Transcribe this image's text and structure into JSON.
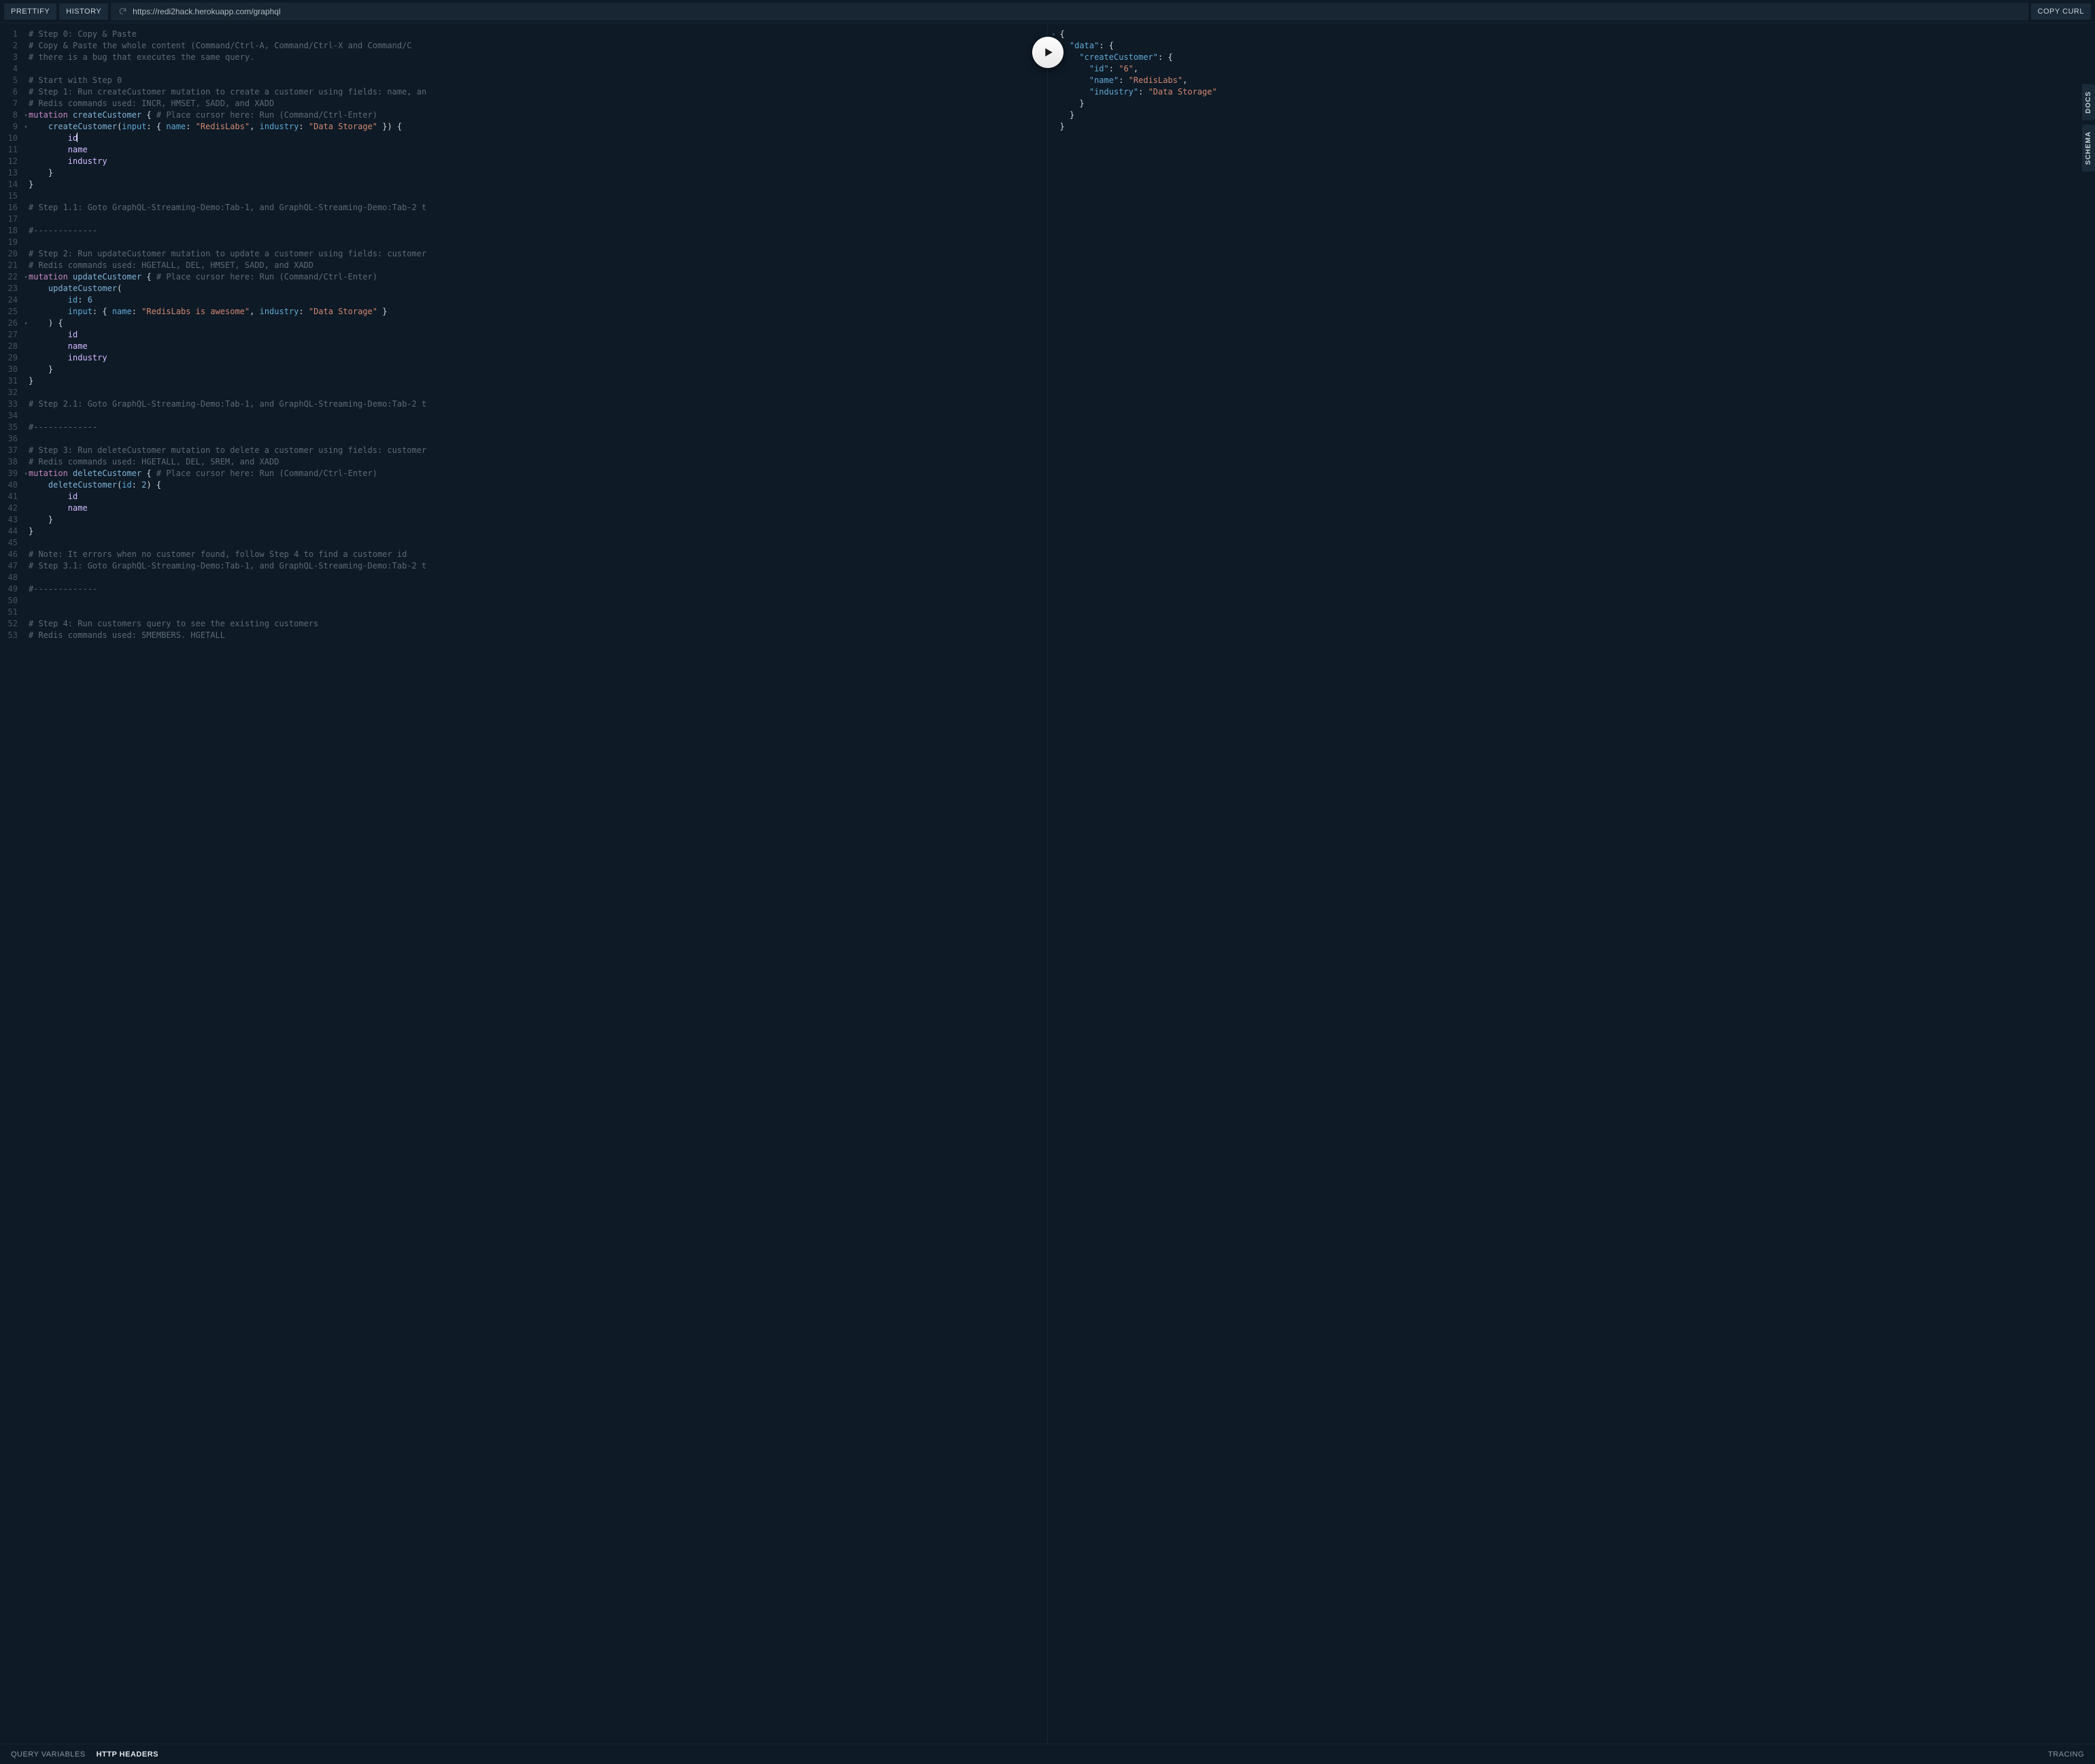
{
  "topbar": {
    "prettify": "PRETTIFY",
    "history": "HISTORY",
    "endpoint": "https://redi2hack.herokuapp.com/graphql",
    "copy_curl": "COPY CURL"
  },
  "side": {
    "docs": "DOCS",
    "schema": "SCHEMA"
  },
  "bottom": {
    "query_variables": "QUERY VARIABLES",
    "http_headers": "HTTP HEADERS",
    "tracing": "TRACING"
  },
  "query_lines": [
    {
      "n": 1,
      "fold": "",
      "tokens": [
        [
          "cm",
          "# Step 0: Copy & Paste"
        ]
      ]
    },
    {
      "n": 2,
      "fold": "",
      "tokens": [
        [
          "cm",
          "# Copy & Paste the whole content (Command/Ctrl-A, Command/Ctrl-X and Command/C"
        ]
      ]
    },
    {
      "n": 3,
      "fold": "",
      "tokens": [
        [
          "cm",
          "# there is a bug that executes the same query."
        ]
      ]
    },
    {
      "n": 4,
      "fold": "",
      "tokens": []
    },
    {
      "n": 5,
      "fold": "",
      "tokens": [
        [
          "cm",
          "# Start with Step 0"
        ]
      ]
    },
    {
      "n": 6,
      "fold": "",
      "tokens": [
        [
          "cm",
          "# Step 1: Run createCustomer mutation to create a customer using fields: name, an"
        ]
      ]
    },
    {
      "n": 7,
      "fold": "",
      "tokens": [
        [
          "cm",
          "# Redis commands used: INCR, HMSET, SADD, and XADD"
        ]
      ]
    },
    {
      "n": 8,
      "fold": "▾",
      "tokens": [
        [
          "kw",
          "mutation"
        ],
        [
          "pun",
          " "
        ],
        [
          "def",
          "createCustomer"
        ],
        [
          "pun",
          " { "
        ],
        [
          "cm",
          "# Place cursor here: Run (Command/Ctrl-Enter)"
        ]
      ]
    },
    {
      "n": 9,
      "fold": "▾",
      "tokens": [
        [
          "pun",
          "    "
        ],
        [
          "fn",
          "createCustomer"
        ],
        [
          "pun",
          "("
        ],
        [
          "attr",
          "input"
        ],
        [
          "pun",
          ": { "
        ],
        [
          "attr",
          "name"
        ],
        [
          "pun",
          ": "
        ],
        [
          "str",
          "\"RedisLabs\""
        ],
        [
          "pun",
          ", "
        ],
        [
          "attr",
          "industry"
        ],
        [
          "pun",
          ": "
        ],
        [
          "str",
          "\"Data Storage\""
        ],
        [
          "pun",
          " }) {"
        ]
      ]
    },
    {
      "n": 10,
      "fold": "",
      "tokens": [
        [
          "pun",
          "        "
        ],
        [
          "var",
          "id"
        ],
        [
          "cursor",
          ""
        ]
      ]
    },
    {
      "n": 11,
      "fold": "",
      "tokens": [
        [
          "pun",
          "        "
        ],
        [
          "var",
          "name"
        ]
      ]
    },
    {
      "n": 12,
      "fold": "",
      "tokens": [
        [
          "pun",
          "        "
        ],
        [
          "var",
          "industry"
        ]
      ]
    },
    {
      "n": 13,
      "fold": "",
      "tokens": [
        [
          "pun",
          "    }"
        ]
      ]
    },
    {
      "n": 14,
      "fold": "",
      "tokens": [
        [
          "pun",
          "}"
        ]
      ]
    },
    {
      "n": 15,
      "fold": "",
      "tokens": []
    },
    {
      "n": 16,
      "fold": "",
      "tokens": [
        [
          "cm",
          "# Step 1.1: Goto GraphQL-Streaming-Demo:Tab-1, and GraphQL-Streaming-Demo:Tab-2 t"
        ]
      ]
    },
    {
      "n": 17,
      "fold": "",
      "tokens": []
    },
    {
      "n": 18,
      "fold": "",
      "tokens": [
        [
          "cm",
          "#-------------"
        ]
      ]
    },
    {
      "n": 19,
      "fold": "",
      "tokens": []
    },
    {
      "n": 20,
      "fold": "",
      "tokens": [
        [
          "cm",
          "# Step 2: Run updateCustomer mutation to update a customer using fields: customer"
        ]
      ]
    },
    {
      "n": 21,
      "fold": "",
      "tokens": [
        [
          "cm",
          "# Redis commands used: HGETALL, DEL, HMSET, SADD, and XADD"
        ]
      ]
    },
    {
      "n": 22,
      "fold": "▾",
      "tokens": [
        [
          "kw",
          "mutation"
        ],
        [
          "pun",
          " "
        ],
        [
          "def",
          "updateCustomer"
        ],
        [
          "pun",
          " { "
        ],
        [
          "cm",
          "# Place cursor here: Run (Command/Ctrl-Enter)"
        ]
      ]
    },
    {
      "n": 23,
      "fold": "",
      "tokens": [
        [
          "pun",
          "    "
        ],
        [
          "fn",
          "updateCustomer"
        ],
        [
          "pun",
          "("
        ]
      ]
    },
    {
      "n": 24,
      "fold": "",
      "tokens": [
        [
          "pun",
          "        "
        ],
        [
          "attr",
          "id"
        ],
        [
          "pun",
          ": "
        ],
        [
          "num",
          "6"
        ]
      ]
    },
    {
      "n": 25,
      "fold": "",
      "tokens": [
        [
          "pun",
          "        "
        ],
        [
          "attr",
          "input"
        ],
        [
          "pun",
          ": { "
        ],
        [
          "attr",
          "name"
        ],
        [
          "pun",
          ": "
        ],
        [
          "str",
          "\"RedisLabs is awesome\""
        ],
        [
          "pun",
          ", "
        ],
        [
          "attr",
          "industry"
        ],
        [
          "pun",
          ": "
        ],
        [
          "str",
          "\"Data Storage\""
        ],
        [
          "pun",
          " }"
        ]
      ]
    },
    {
      "n": 26,
      "fold": "▾",
      "tokens": [
        [
          "pun",
          "    ) {"
        ]
      ]
    },
    {
      "n": 27,
      "fold": "",
      "tokens": [
        [
          "pun",
          "        "
        ],
        [
          "var",
          "id"
        ]
      ]
    },
    {
      "n": 28,
      "fold": "",
      "tokens": [
        [
          "pun",
          "        "
        ],
        [
          "var",
          "name"
        ]
      ]
    },
    {
      "n": 29,
      "fold": "",
      "tokens": [
        [
          "pun",
          "        "
        ],
        [
          "var",
          "industry"
        ]
      ]
    },
    {
      "n": 30,
      "fold": "",
      "tokens": [
        [
          "pun",
          "    }"
        ]
      ]
    },
    {
      "n": 31,
      "fold": "",
      "tokens": [
        [
          "pun",
          "}"
        ]
      ]
    },
    {
      "n": 32,
      "fold": "",
      "tokens": []
    },
    {
      "n": 33,
      "fold": "",
      "tokens": [
        [
          "cm",
          "# Step 2.1: Goto GraphQL-Streaming-Demo:Tab-1, and GraphQL-Streaming-Demo:Tab-2 t"
        ]
      ]
    },
    {
      "n": 34,
      "fold": "",
      "tokens": []
    },
    {
      "n": 35,
      "fold": "",
      "tokens": [
        [
          "cm",
          "#-------------"
        ]
      ]
    },
    {
      "n": 36,
      "fold": "",
      "tokens": []
    },
    {
      "n": 37,
      "fold": "",
      "tokens": [
        [
          "cm",
          "# Step 3: Run deleteCustomer mutation to delete a customer using fields: customer"
        ]
      ]
    },
    {
      "n": 38,
      "fold": "",
      "tokens": [
        [
          "cm",
          "# Redis commands used: HGETALL, DEL, SREM, and XADD"
        ]
      ]
    },
    {
      "n": 39,
      "fold": "▾",
      "tokens": [
        [
          "kw",
          "mutation"
        ],
        [
          "pun",
          " "
        ],
        [
          "def",
          "deleteCustomer"
        ],
        [
          "pun",
          " { "
        ],
        [
          "cm",
          "# Place cursor here: Run (Command/Ctrl-Enter)"
        ]
      ]
    },
    {
      "n": 40,
      "fold": "",
      "tokens": [
        [
          "pun",
          "    "
        ],
        [
          "fn",
          "deleteCustomer"
        ],
        [
          "pun",
          "("
        ],
        [
          "attr",
          "id"
        ],
        [
          "pun",
          ": "
        ],
        [
          "num",
          "2"
        ],
        [
          "pun",
          ") {"
        ]
      ]
    },
    {
      "n": 41,
      "fold": "",
      "tokens": [
        [
          "pun",
          "        "
        ],
        [
          "var",
          "id"
        ]
      ]
    },
    {
      "n": 42,
      "fold": "",
      "tokens": [
        [
          "pun",
          "        "
        ],
        [
          "var",
          "name"
        ]
      ]
    },
    {
      "n": 43,
      "fold": "",
      "tokens": [
        [
          "pun",
          "    }"
        ]
      ]
    },
    {
      "n": 44,
      "fold": "",
      "tokens": [
        [
          "pun",
          "}"
        ]
      ]
    },
    {
      "n": 45,
      "fold": "",
      "tokens": []
    },
    {
      "n": 46,
      "fold": "",
      "tokens": [
        [
          "cm",
          "# Note: It errors when no customer found, follow Step 4 to find a customer id"
        ]
      ]
    },
    {
      "n": 47,
      "fold": "",
      "tokens": [
        [
          "cm",
          "# Step 3.1: Goto GraphQL-Streaming-Demo:Tab-1, and GraphQL-Streaming-Demo:Tab-2 t"
        ]
      ]
    },
    {
      "n": 48,
      "fold": "",
      "tokens": []
    },
    {
      "n": 49,
      "fold": "",
      "tokens": [
        [
          "cm",
          "#-------------"
        ]
      ]
    },
    {
      "n": 50,
      "fold": "",
      "tokens": []
    },
    {
      "n": 51,
      "fold": "",
      "tokens": []
    },
    {
      "n": 52,
      "fold": "",
      "tokens": [
        [
          "cm",
          "# Step 4: Run customers query to see the existing customers"
        ]
      ]
    },
    {
      "n": 53,
      "fold": "",
      "tokens": [
        [
          "cm",
          "# Redis commands used: SMEMBERS. HGETALL"
        ]
      ]
    }
  ],
  "result_lines": [
    {
      "fold": "▾",
      "indent": 0,
      "tokens": [
        [
          "pun",
          "{"
        ]
      ]
    },
    {
      "fold": "▾",
      "indent": 1,
      "tokens": [
        [
          "jkey",
          "\"data\""
        ],
        [
          "pun",
          ": {"
        ]
      ]
    },
    {
      "fold": "▾",
      "indent": 2,
      "tokens": [
        [
          "jkey",
          "\"createCustomer\""
        ],
        [
          "pun",
          ": {"
        ]
      ]
    },
    {
      "fold": "",
      "indent": 3,
      "tokens": [
        [
          "jkey",
          "\"id\""
        ],
        [
          "pun",
          ": "
        ],
        [
          "jstr",
          "\"6\""
        ],
        [
          "pun",
          ","
        ]
      ]
    },
    {
      "fold": "",
      "indent": 3,
      "tokens": [
        [
          "jkey",
          "\"name\""
        ],
        [
          "pun",
          ": "
        ],
        [
          "jstr",
          "\"RedisLabs\""
        ],
        [
          "pun",
          ","
        ]
      ]
    },
    {
      "fold": "",
      "indent": 3,
      "tokens": [
        [
          "jkey",
          "\"industry\""
        ],
        [
          "pun",
          ": "
        ],
        [
          "jstr",
          "\"Data Storage\""
        ]
      ]
    },
    {
      "fold": "",
      "indent": 2,
      "tokens": [
        [
          "pun",
          "}"
        ]
      ]
    },
    {
      "fold": "",
      "indent": 1,
      "tokens": [
        [
          "pun",
          "}"
        ]
      ]
    },
    {
      "fold": "",
      "indent": 0,
      "tokens": [
        [
          "pun",
          "}"
        ]
      ]
    }
  ],
  "result_data": {
    "data": {
      "createCustomer": {
        "id": "6",
        "name": "RedisLabs",
        "industry": "Data Storage"
      }
    }
  }
}
